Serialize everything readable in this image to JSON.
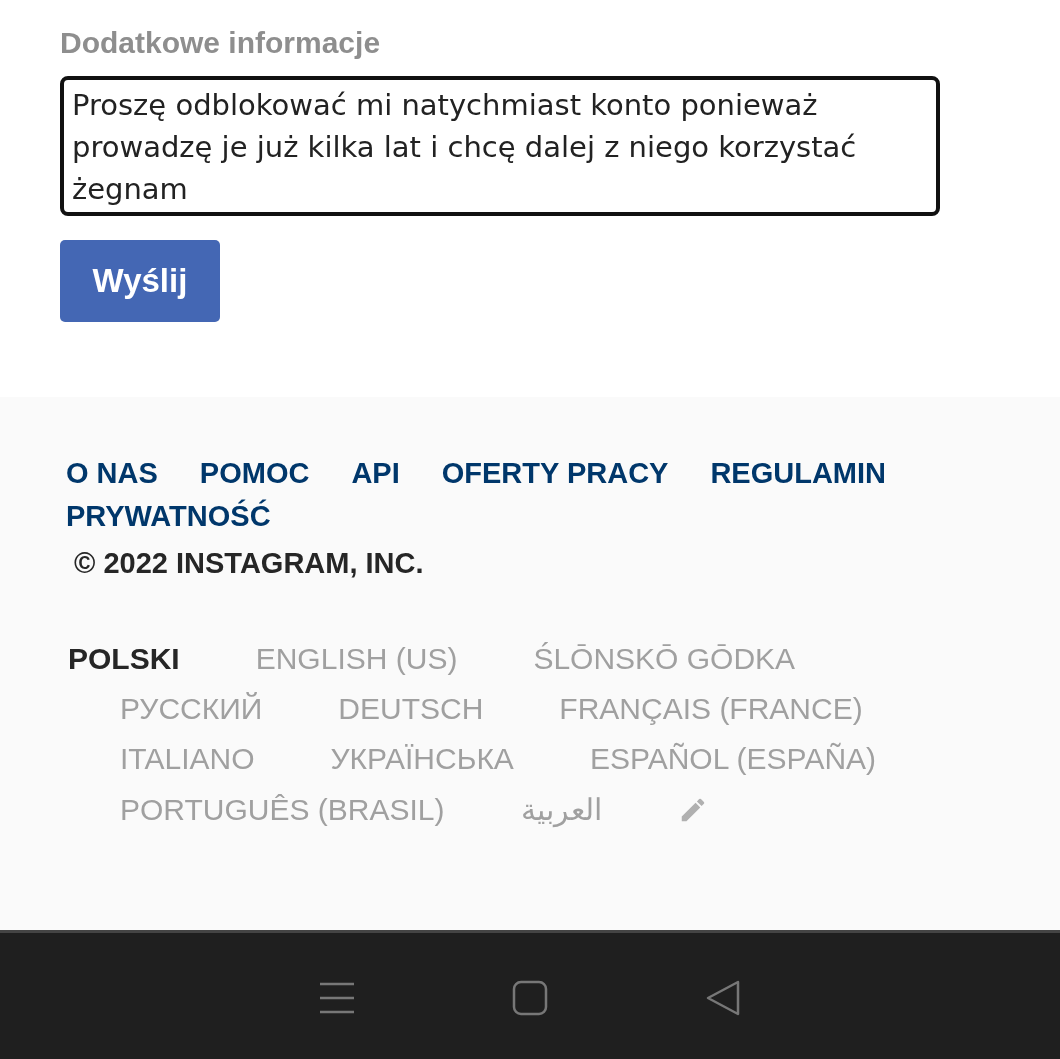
{
  "form": {
    "label": "Dodatkowe informacje",
    "textarea_value": "Proszę odblokować mi natychmiast konto ponieważ prowadzę je już kilka lat i chcę dalej z niego korzystać żegnam",
    "submit": "Wyślij"
  },
  "footer": {
    "links": [
      "O NAS",
      "POMOC",
      "API",
      "OFERTY PRACY",
      "REGULAMIN",
      "PRYWATNOŚĆ"
    ],
    "copyright": "© 2022 INSTAGRAM, INC.",
    "languages": [
      {
        "label": "POLSKI",
        "selected": true
      },
      {
        "label": "ENGLISH (US)",
        "selected": false
      },
      {
        "label": "ŚLŌNSKŌ GŌDKA",
        "selected": false
      },
      {
        "label": "РУССКИЙ",
        "selected": false
      },
      {
        "label": "DEUTSCH",
        "selected": false
      },
      {
        "label": "FRANÇAIS (FRANCE)",
        "selected": false
      },
      {
        "label": "ITALIANO",
        "selected": false
      },
      {
        "label": "УКРАЇНСЬКА",
        "selected": false
      },
      {
        "label": "ESPAÑOL (ESPAÑA)",
        "selected": false
      },
      {
        "label": "PORTUGUÊS (BRASIL)",
        "selected": false
      },
      {
        "label": "العربية",
        "selected": false
      }
    ]
  }
}
